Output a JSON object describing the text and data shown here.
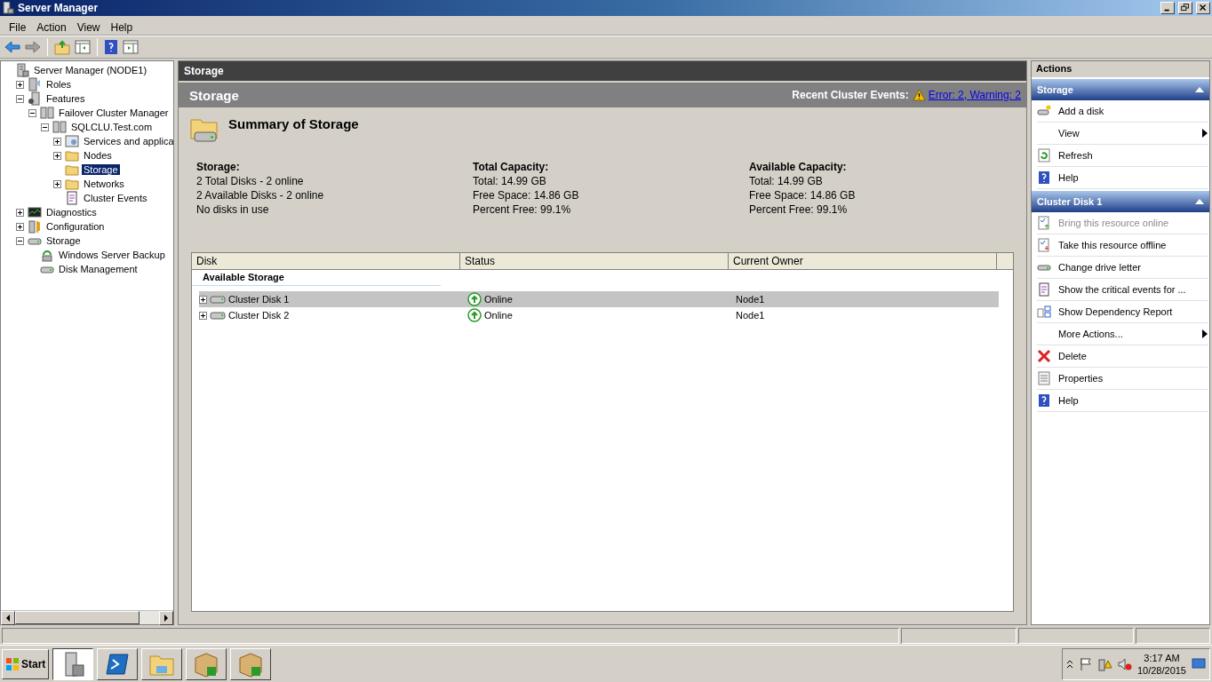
{
  "window": {
    "title": "Server Manager"
  },
  "menu": [
    "File",
    "Action",
    "View",
    "Help"
  ],
  "tree": [
    {
      "label": "Server Manager (NODE1)",
      "kind": "server",
      "selected": false,
      "children": [
        {
          "label": "Roles",
          "kind": "roles",
          "selected": false,
          "expanded": false
        },
        {
          "label": "Features",
          "kind": "features",
          "selected": false,
          "expanded": true,
          "children": [
            {
              "label": "Failover Cluster Manager",
              "kind": "cluster",
              "selected": false,
              "expanded": true,
              "children": [
                {
                  "label": "SQLCLU.Test.com",
                  "kind": "cluster",
                  "selected": false,
                  "expanded": true,
                  "children": [
                    {
                      "label": "Services and applica",
                      "kind": "services",
                      "selected": false,
                      "expanded": false
                    },
                    {
                      "label": "Nodes",
                      "kind": "folder",
                      "selected": false,
                      "expanded": false
                    },
                    {
                      "label": "Storage",
                      "kind": "folder",
                      "selected": true
                    },
                    {
                      "label": "Networks",
                      "kind": "folder",
                      "selected": false,
                      "expanded": false
                    },
                    {
                      "label": "Cluster Events",
                      "kind": "events",
                      "selected": false
                    }
                  ]
                }
              ]
            }
          ]
        },
        {
          "label": "Diagnostics",
          "kind": "diagnostics",
          "selected": false,
          "expanded": false
        },
        {
          "label": "Configuration",
          "kind": "config",
          "selected": false,
          "expanded": false
        },
        {
          "label": "Storage",
          "kind": "storage",
          "selected": false,
          "expanded": true,
          "children": [
            {
              "label": "Windows Server Backup",
              "kind": "backup",
              "selected": false
            },
            {
              "label": "Disk Management",
              "kind": "disk",
              "selected": false
            }
          ]
        }
      ]
    }
  ],
  "center": {
    "header": "Storage",
    "subheader": "Storage",
    "events_label": "Recent Cluster Events:",
    "events_link": "Error: 2, Warning: 2",
    "summary_title": "Summary of Storage",
    "summary": [
      {
        "heading": "Storage:",
        "lines": [
          "2 Total Disks - 2 online",
          "2 Available Disks - 2 online",
          "No disks in use"
        ]
      },
      {
        "heading": "Total Capacity:",
        "lines": [
          "Total: 14.99 GB",
          "Free Space: 14.86 GB",
          "Percent Free: 99.1%"
        ]
      },
      {
        "heading": "Available Capacity:",
        "lines": [
          "Total: 14.99 GB",
          "Free Space: 14.86 GB",
          "Percent Free: 99.1%"
        ]
      }
    ],
    "table": {
      "columns": [
        "Disk",
        "Status",
        "Current Owner"
      ],
      "group": "Available Storage",
      "rows": [
        {
          "disk": "Cluster Disk 1",
          "status": "Online",
          "owner": "Node1",
          "selected": true,
          "expanded": false
        },
        {
          "disk": "Cluster Disk 2",
          "status": "Online",
          "owner": "Node1",
          "selected": false,
          "expanded": false
        }
      ]
    }
  },
  "actions": {
    "title": "Actions",
    "sections": [
      {
        "title": "Storage",
        "expanded": true,
        "items": [
          {
            "label": "Add a disk",
            "kind": "disk",
            "disabled": false
          },
          {
            "label": "View",
            "kind": "submenu",
            "disabled": false
          },
          {
            "label": "Refresh",
            "kind": "refresh",
            "disabled": false
          },
          {
            "label": "Help",
            "kind": "help",
            "disabled": false
          }
        ]
      },
      {
        "title": "Cluster Disk 1",
        "expanded": true,
        "items": [
          {
            "label": "Bring this resource online",
            "kind": "online",
            "disabled": true
          },
          {
            "label": "Take this resource offline",
            "kind": "offline",
            "disabled": false
          },
          {
            "label": "Change drive letter",
            "kind": "drive",
            "disabled": false
          },
          {
            "label": "Show the critical events for ...",
            "kind": "events",
            "disabled": false
          },
          {
            "label": "Show Dependency Report",
            "kind": "report",
            "disabled": false
          },
          {
            "label": "More Actions...",
            "kind": "submenu",
            "disabled": false
          },
          {
            "label": "Delete",
            "kind": "delete",
            "disabled": false
          },
          {
            "label": "Properties",
            "kind": "properties",
            "disabled": false
          },
          {
            "label": "Help",
            "kind": "help",
            "disabled": false
          }
        ]
      }
    ]
  },
  "taskbar": {
    "start": "Start",
    "time": "3:17 AM",
    "date": "10/28/2015"
  }
}
